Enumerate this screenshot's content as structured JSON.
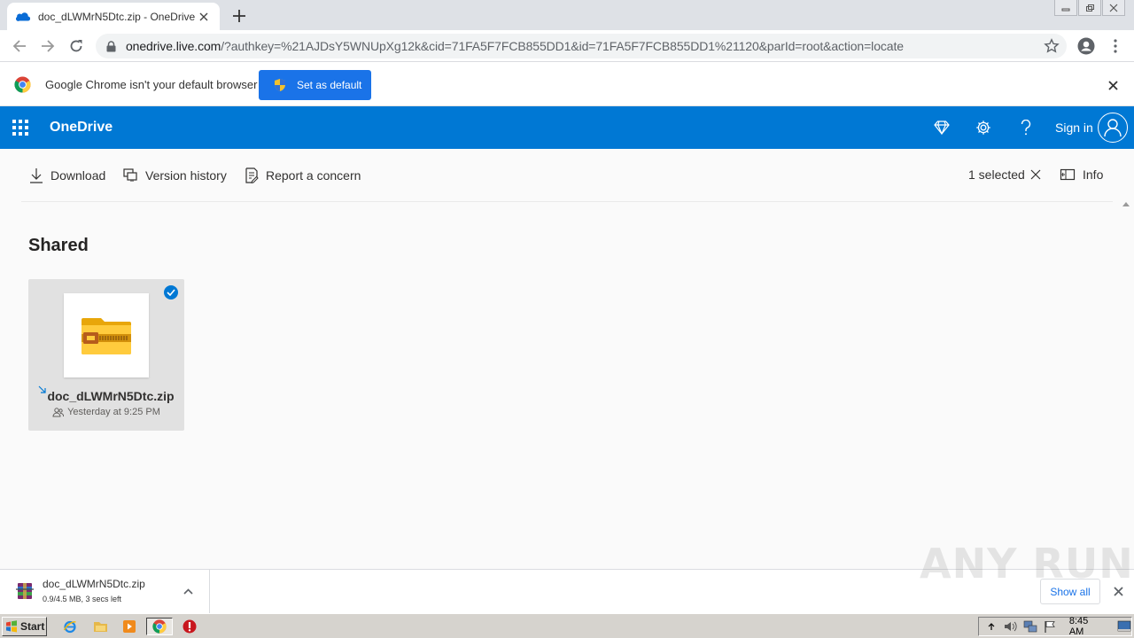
{
  "browser": {
    "tab_title": "doc_dLWMrN5Dtc.zip - OneDrive",
    "url_host": "onedrive.live.com",
    "url_rest": "/?authkey=%21AJDsY5WNUpXg12k&cid=71FA5F7FCB855DD1&id=71FA5F7FCB855DD1%21120&parId=root&action=locate"
  },
  "infobar": {
    "message": "Google Chrome isn't your default browser",
    "button_label": "Set as default"
  },
  "onedrive": {
    "brand": "OneDrive",
    "sign_in": "Sign in",
    "accent_color": "#0078d4"
  },
  "commands": {
    "download": "Download",
    "version_history": "Version history",
    "report": "Report a concern",
    "selected": "1 selected",
    "info": "Info"
  },
  "main": {
    "heading": "Shared",
    "items": [
      {
        "name": "doc_dLWMrN5Dtc.zip",
        "meta": "Yesterday at 9:25 PM",
        "selected": true,
        "icon": "zip-folder-icon"
      }
    ]
  },
  "downloads": {
    "file_name": "doc_dLWMrN5Dtc.zip",
    "status": "0.9/4.5 MB, 3 secs left",
    "show_all": "Show all",
    "watermark": "ANY RUN"
  },
  "taskbar": {
    "start": "Start",
    "clock": "8:45 AM"
  }
}
